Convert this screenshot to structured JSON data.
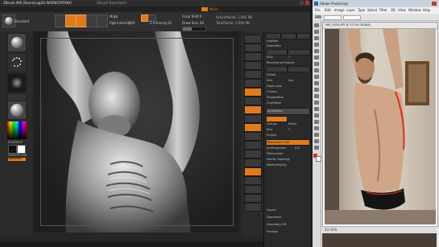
{
  "zbrush": {
    "title": "ZBrush 4R6 [Dominic@DC-WORKSTATION]",
    "title_extra": "ZBrush Document",
    "menu_hint": "Move",
    "mode_buttons": [
      "Edit",
      "Draw",
      "Move",
      "Scale",
      "Rotate"
    ],
    "toolbar_sliders": [
      {
        "label": "Mrgb",
        "value": ""
      },
      {
        "label": "Rgb Intensity",
        "value": "100"
      },
      {
        "label": "Z Intensity",
        "value": "25"
      },
      {
        "label": "Focal Shift",
        "value": "0"
      },
      {
        "label": "Draw Size",
        "value": "64"
      }
    ],
    "active_points_label": "ActivePoints: 2.064 Mil",
    "total_points_label": "TotalPoints: 2.064 Mil",
    "left_panel_label": "Standard",
    "color_label": "SwitchColor",
    "gradient_label": "Gradient",
    "alternate_label": "Alternate",
    "right_shelf": [
      "BPR",
      "SPix 3",
      "Scroll",
      "Zoom",
      "Actual",
      "AAHalf",
      "Persp",
      "Floor",
      "Local",
      "L.Sym",
      "Xyz",
      "Frame",
      "Move",
      "Scale",
      "Rotate",
      "Line Fill",
      "Transp",
      "Ghost",
      "Solo",
      "Xpose"
    ],
    "tray": {
      "top_buttons": [
        "Lightbox",
        "Load Tool",
        "Save As"
      ],
      "items": [
        {
          "label": "SubTool",
          "value": ""
        },
        {
          "label": "Geometry",
          "value": ""
        },
        {
          "label": "Lower Res",
          "value": "Higher Res"
        },
        {
          "label": "SDiv",
          "value": "7"
        },
        {
          "label": "Reconstruct Subdiv",
          "value": ""
        },
        {
          "label": "Del Lower",
          "value": "Del Higher"
        },
        {
          "label": "Divide",
          "value": ""
        },
        {
          "label": "Smt",
          "value": "Suv"
        },
        {
          "label": "Edge Loop",
          "value": ""
        },
        {
          "label": "Crease",
          "value": ""
        },
        {
          "label": "ShadowBox",
          "value": ""
        },
        {
          "label": "ClayPolish",
          "value": ""
        },
        {
          "label": "DynaMesh",
          "value": ""
        },
        {
          "label": "Groups",
          "value": "Polish"
        },
        {
          "label": "Blur",
          "value": "2"
        },
        {
          "label": "Project",
          "value": "Resolution 128"
        },
        {
          "label": "SubProjection",
          "value": "0.6"
        },
        {
          "label": "ZRemesher",
          "value": ""
        },
        {
          "label": "Modify Topology",
          "value": ""
        },
        {
          "label": "MeshIntegrity",
          "value": ""
        },
        {
          "label": "Layers",
          "value": ""
        },
        {
          "label": "FiberMesh",
          "value": ""
        },
        {
          "label": "Geometry HD",
          "value": ""
        },
        {
          "label": "Preview",
          "value": ""
        }
      ]
    },
    "accent_color": "#e07b1e"
  },
  "photoshop": {
    "title": "Adobe Photoshop",
    "menu": [
      "File",
      "Edit",
      "Image",
      "Layer",
      "Type",
      "Select",
      "Filter",
      "3D",
      "View",
      "Window",
      "Help"
    ],
    "doc_tab": "IMG_5039.JPG @ 33.3% (RGB/8)",
    "status": "33.33%",
    "annotation_color": "#e03020"
  }
}
